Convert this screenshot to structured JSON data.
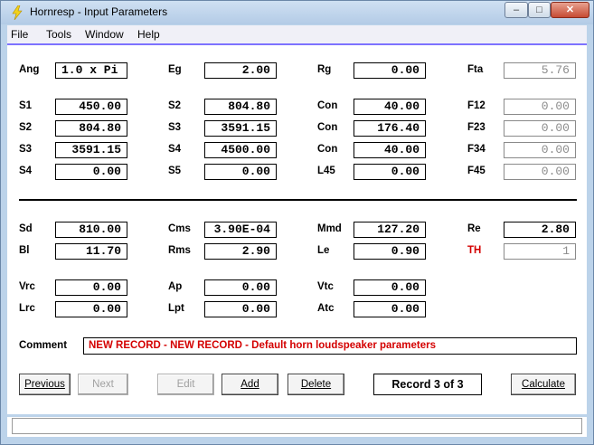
{
  "window": {
    "title": "Hornresp - Input Parameters"
  },
  "menu": [
    "File",
    "Tools",
    "Window",
    "Help"
  ],
  "labels": {
    "ang": "Ang",
    "eg": "Eg",
    "rg": "Rg",
    "fta": "Fta",
    "s1": "S1",
    "s2": "S2",
    "s3": "S3",
    "s4": "S4",
    "s5": "S5",
    "con": "Con",
    "l45": "L45",
    "f12": "F12",
    "f23": "F23",
    "f34": "F34",
    "f45": "F45",
    "sd": "Sd",
    "cms": "Cms",
    "mmd": "Mmd",
    "re": "Re",
    "bl": "Bl",
    "rms": "Rms",
    "le": "Le",
    "th": "TH",
    "vrc": "Vrc",
    "ap": "Ap",
    "vtc": "Vtc",
    "lrc": "Lrc",
    "lpt": "Lpt",
    "atc": "Atc",
    "comment": "Comment"
  },
  "fields": {
    "ang": "1.0 x Pi",
    "eg": "2.00",
    "rg": "0.00",
    "fta": "5.76",
    "row1": {
      "s1": "450.00",
      "s2": "804.80",
      "con": "40.00",
      "f12": "0.00"
    },
    "row2": {
      "s2": "804.80",
      "s3": "3591.15",
      "con": "176.40",
      "f23": "0.00"
    },
    "row3": {
      "s3": "3591.15",
      "s4": "4500.00",
      "con": "40.00",
      "f34": "0.00"
    },
    "row4": {
      "s4": "0.00",
      "s5": "0.00",
      "l45": "0.00",
      "f45": "0.00"
    },
    "sd": "810.00",
    "cms": "3.90E-04",
    "mmd": "127.20",
    "re": "2.80",
    "bl": "11.70",
    "rms": "2.90",
    "le": "0.90",
    "th": "1",
    "vrc": "0.00",
    "ap": "0.00",
    "vtc": "0.00",
    "lrc": "0.00",
    "lpt": "0.00",
    "atc": "0.00"
  },
  "comment": "NEW RECORD - NEW RECORD - Default horn loudspeaker parameters",
  "buttons": {
    "previous": "Previous",
    "next": "Next",
    "edit": "Edit",
    "add": "Add",
    "delete": "Delete",
    "calculate": "Calculate"
  },
  "record": "Record 3 of 3",
  "colors": {
    "label_red": "#d40000",
    "menu_underline": "#7d72ff"
  }
}
